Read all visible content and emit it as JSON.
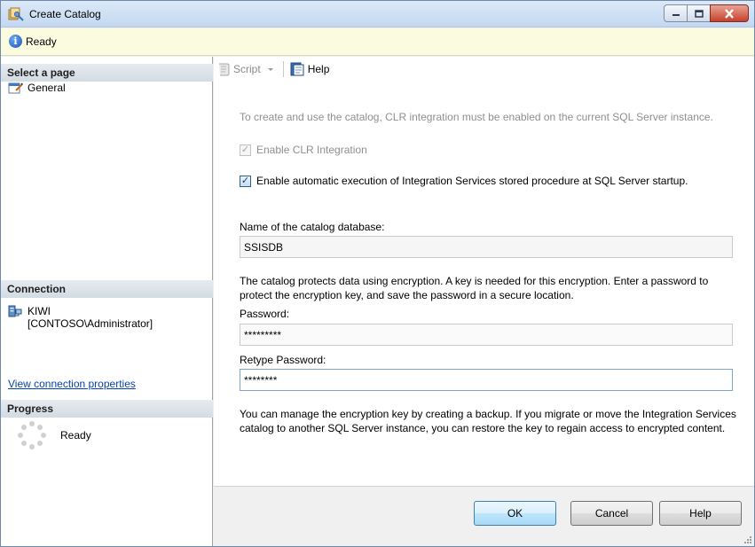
{
  "window": {
    "title": "Create Catalog",
    "controls": {
      "minimize": "minimize-icon",
      "maximize": "maximize-icon",
      "close": "close-icon"
    }
  },
  "statusbar": {
    "icon": "info-icon",
    "text": "Ready"
  },
  "sidebar": {
    "select_page_header": "Select a page",
    "pages": [
      {
        "label": "General",
        "icon": "general-page-icon"
      }
    ],
    "connection_header": "Connection",
    "connection": {
      "server": "KIWI",
      "user": "[CONTOSO\\Administrator]",
      "icon": "server-connection-icon"
    },
    "view_connection_link": "View connection properties",
    "progress_header": "Progress",
    "progress_status": "Ready"
  },
  "toolbar": {
    "script_label": "Script",
    "help_label": "Help"
  },
  "form": {
    "clr_note": "To create and use the catalog, CLR integration must be enabled on the current SQL Server instance.",
    "enable_clr": {
      "label": "Enable CLR Integration",
      "checked": true,
      "disabled": true
    },
    "auto_exec": {
      "label": "Enable automatic execution of Integration Services stored procedure at SQL Server startup.",
      "checked": true
    },
    "catalog_db_label": "Name of the catalog database:",
    "catalog_db_value": "SSISDB",
    "encryption_note": "The catalog protects data using encryption. A key is needed for this encryption. Enter a password to protect the encryption key, and save the password in a secure location.",
    "password_label": "Password:",
    "password_value": "*********",
    "retype_label": "Retype Password:",
    "retype_value": "********",
    "backup_note": "You can manage the encryption key by creating a backup. If you migrate or move the Integration Services catalog to another SQL Server instance, you can restore the key to regain access to encrypted content."
  },
  "buttons": {
    "ok": "OK",
    "cancel": "Cancel",
    "help": "Help"
  },
  "colors": {
    "accent": "#3c7fb1",
    "link": "#0645ad",
    "status_background": "#fbfbdf"
  }
}
